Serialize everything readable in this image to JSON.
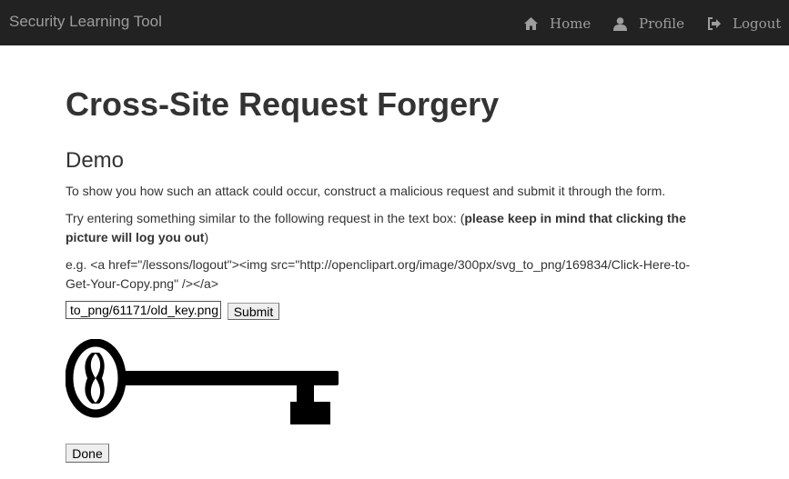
{
  "navbar": {
    "brand": "Security Learning Tool",
    "home": {
      "icon": "home-icon",
      "label": "Home"
    },
    "profile": {
      "icon": "user-icon",
      "label": "Profile"
    },
    "logout": {
      "icon": "logout-icon",
      "label": "Logout"
    }
  },
  "page": {
    "title": "Cross-Site Request Forgery",
    "section": "Demo",
    "intro": "To show you how such an attack could occur, construct a malicious request and submit it through the form.",
    "instruction_start": "Try entering something similar to the following request in the text box: (",
    "instruction_bold": "please keep in mind that clicking the picture will log you out",
    "instruction_end": ")",
    "example": "e.g. <a href=\"/lessons/logout\"><img src=\"http://openclipart.org/image/300px/svg_to_png/169834/Click-Here-to-Get-Your-Copy.png\" /></a>"
  },
  "form": {
    "input_value": "to_png/61171/old_key.png",
    "submit_label": "Submit"
  },
  "image": {
    "icon": "old-key-icon"
  },
  "done_label": "Done",
  "colors": {
    "navbar_bg": "#222222",
    "navbar_text": "#9d9d9d",
    "text": "#333333"
  }
}
